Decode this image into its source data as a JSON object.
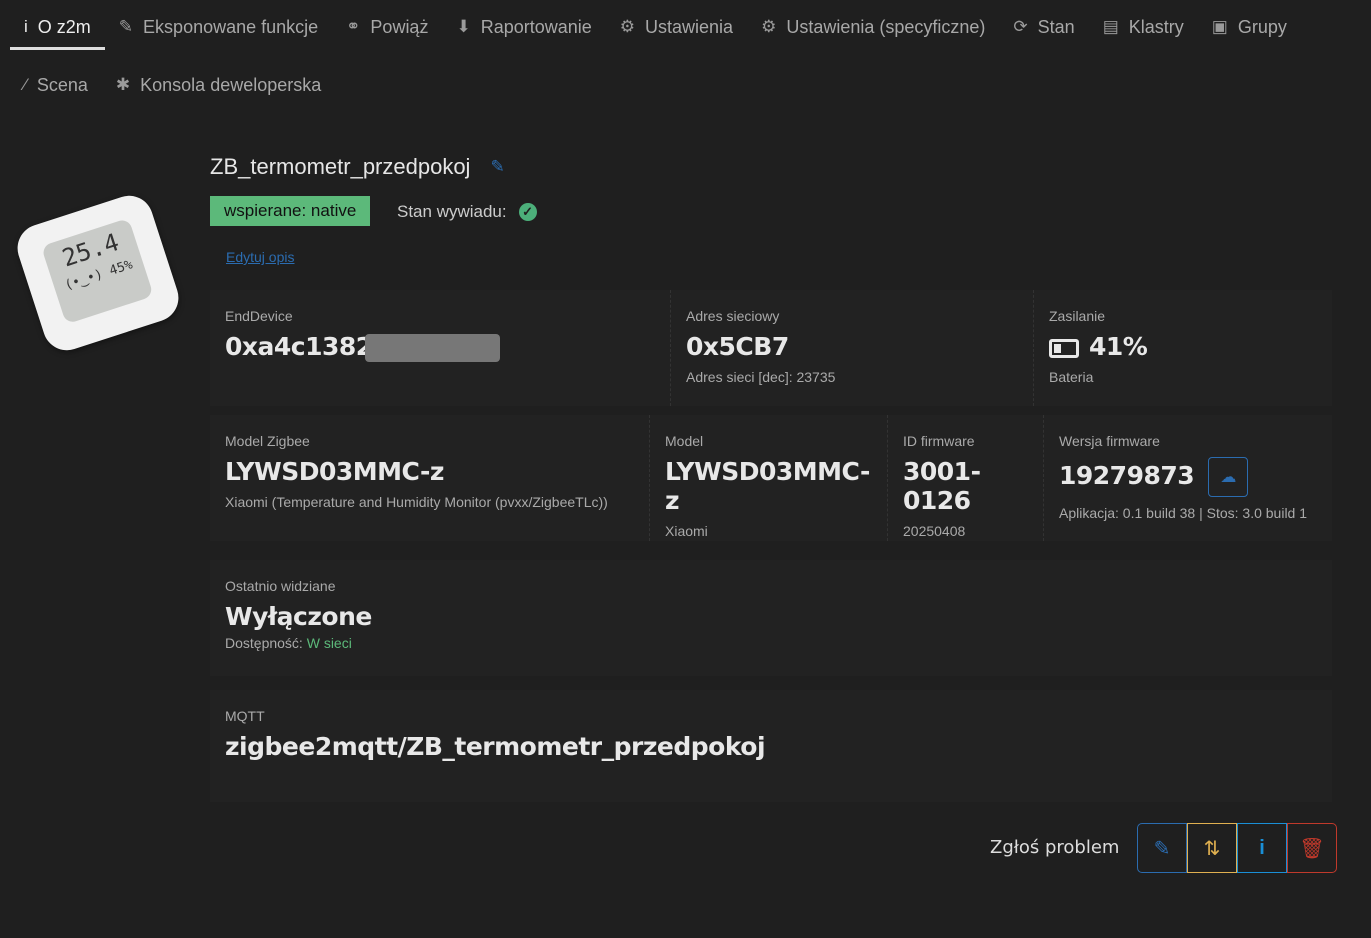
{
  "tabs": [
    {
      "label": "O z2m",
      "icon": "info-icon",
      "glyph": "i",
      "active": true
    },
    {
      "label": "Eksponowane funkcje",
      "icon": "pencil-icon",
      "glyph": "✎"
    },
    {
      "label": "Powiąż",
      "icon": "link-icon",
      "glyph": "⚭"
    },
    {
      "label": "Raportowanie",
      "icon": "arrow-down-icon",
      "glyph": "⬇"
    },
    {
      "label": "Ustawienia",
      "icon": "gears-icon",
      "glyph": "⚙"
    },
    {
      "label": "Ustawienia (specyficzne)",
      "icon": "gear-icon",
      "glyph": "⚙"
    },
    {
      "label": "Stan",
      "icon": "refresh-icon",
      "glyph": "⟳"
    },
    {
      "label": "Klastry",
      "icon": "list-icon",
      "glyph": "▤"
    },
    {
      "label": "Grupy",
      "icon": "group-icon",
      "glyph": "▣"
    },
    {
      "label": "Scena",
      "icon": "magic-icon",
      "glyph": "⁄"
    },
    {
      "label": "Konsola deweloperska",
      "icon": "bug-icon",
      "glyph": "✱"
    }
  ],
  "device": {
    "name": "ZB_termometr_przedpokoj",
    "screen_temp": "25.4",
    "screen_hum": "(•‿•) 45%",
    "support_badge": "wspierane: native",
    "interview_label": "Stan wywiadu:",
    "edit_desc": "Edytuj opis"
  },
  "info": {
    "type_label": "EndDevice",
    "ieee": "0xa4c1382",
    "net_label": "Adres sieciowy",
    "net": "0x5CB7",
    "net_dec": "Adres sieci [dec]: 23735",
    "power_label": "Zasilanie",
    "power": "41%",
    "power_src": "Bateria",
    "zmodel_label": "Model Zigbee",
    "zmodel": "LYWSD03MMC-z",
    "zmodel_desc": "Xiaomi (Temperature and Humidity Monitor (pvxx/ZigbeeTLc))",
    "model_label": "Model",
    "model": "LYWSD03MMC-z",
    "vendor": "Xiaomi",
    "fwid_label": "ID firmware",
    "fwid": "3001-0126",
    "fwdate": "20250408",
    "fwver_label": "Wersja firmware",
    "fwver": "19279873",
    "fwver_desc": "Aplikacja: 0.1 build 38 | Stos: 3.0 build 1",
    "seen_label": "Ostatnio widziane",
    "seen": "Wyłączone",
    "avail_label": "Dostępność:",
    "avail": "W sieci",
    "mqtt_label": "MQTT",
    "mqtt": "zigbee2mqtt/ZB_termometr_przedpokoj"
  },
  "actions": {
    "report": "Zgłoś problem"
  },
  "colors": {
    "edit": "#2b6cb0",
    "reconfigure": "#e0b050",
    "info": "#1a8fd6",
    "delete": "#c0392b"
  }
}
